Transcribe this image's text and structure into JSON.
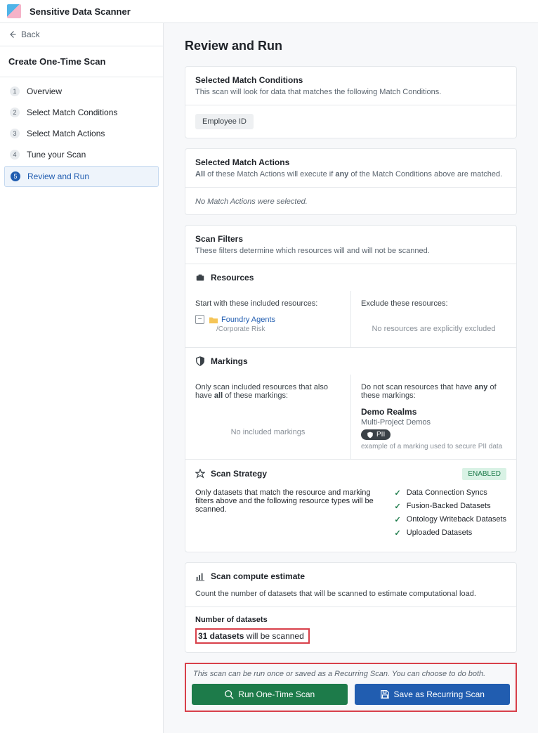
{
  "header": {
    "title": "Sensitive Data Scanner"
  },
  "back_label": "Back",
  "sidebar_title": "Create One-Time Scan",
  "steps": [
    {
      "num": "1",
      "label": "Overview"
    },
    {
      "num": "2",
      "label": "Select Match Conditions"
    },
    {
      "num": "3",
      "label": "Select Match Actions"
    },
    {
      "num": "4",
      "label": "Tune your Scan"
    },
    {
      "num": "5",
      "label": "Review and Run"
    }
  ],
  "page_title": "Review and Run",
  "conditions": {
    "title": "Selected Match Conditions",
    "desc": "This scan will look for data that matches the following Match Conditions.",
    "chip": "Employee ID"
  },
  "actions": {
    "title": "Selected Match Actions",
    "desc_pre": "All",
    "desc_mid": " of these Match Actions will execute if ",
    "desc_bold": "any",
    "desc_post": " of the Match Conditions above are matched.",
    "empty": "No Match Actions were selected."
  },
  "filters": {
    "title": "Scan Filters",
    "desc": "These filters determine which resources will and will not be scanned.",
    "resources_label": "Resources",
    "include_label": "Start with these included resources:",
    "resource_name": "Foundry Agents",
    "resource_path": "/Corporate Risk",
    "exclude_label": "Exclude these resources:",
    "exclude_empty": "No resources are explicitly excluded",
    "markings_label": "Markings",
    "markings_include_pre": "Only scan included resources that also have ",
    "markings_include_bold": "all",
    "markings_include_post": " of these markings:",
    "markings_none": "No included markings",
    "markings_exclude_pre": "Do not scan resources that have ",
    "markings_exclude_bold": "any",
    "markings_exclude_post": " of these markings:",
    "realm": "Demo Realms",
    "realm_sub": "Multi-Project Demos",
    "pii": "PII",
    "pii_note": "example of a marking used to secure PII data",
    "strategy_label": "Scan Strategy",
    "enabled": "ENABLED",
    "strategy_desc": "Only datasets that match the resource and marking filters above and the following resource types will be scanned.",
    "strategy_items": [
      "Data Connection Syncs",
      "Fusion-Backed Datasets",
      "Ontology Writeback Datasets",
      "Uploaded Datasets"
    ]
  },
  "estimate": {
    "title": "Scan compute estimate",
    "desc": "Count the number of datasets that will be scanned to estimate computational load.",
    "num_label": "Number of datasets",
    "count_bold": "31 datasets",
    "count_rest": " will be scanned"
  },
  "run": {
    "note": "This scan can be run once or saved as a Recurring Scan. You can choose to do both.",
    "btn_once": "Run One-Time Scan",
    "btn_recur": "Save as Recurring Scan"
  }
}
